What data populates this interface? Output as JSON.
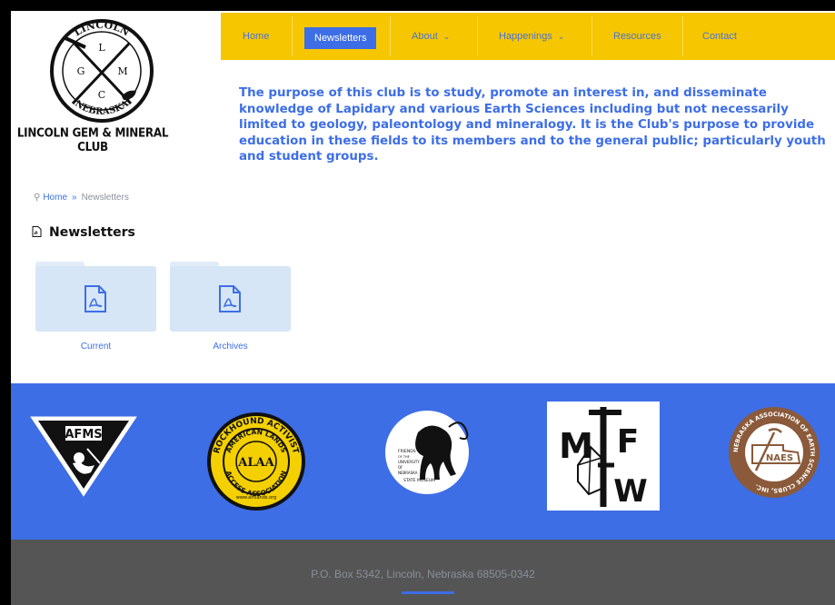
{
  "logo": {
    "arc_top": "LINCOLN",
    "arc_bottom": "NEBRASKA",
    "letters": [
      "L",
      "G",
      "M",
      "C"
    ],
    "caption": "LINCOLN GEM & MINERAL CLUB"
  },
  "nav": {
    "items": [
      {
        "label": "Home"
      },
      {
        "label": "Newsletters",
        "active": true
      },
      {
        "label": "About",
        "caret": "⌄"
      },
      {
        "label": "Happenings",
        "caret": "⌄"
      },
      {
        "label": "Resources"
      },
      {
        "label": "Contact"
      }
    ]
  },
  "purpose": "The purpose of this club is to study, promote an interest in, and disseminate knowledge of Lapidary and various Earth Sciences including but not necessarily limited to geology, paleontology and mineralogy. It is the Club's purpose to provide education in these fields to its members and to the general public; particularly youth and student groups.",
  "breadcrumb": {
    "home": "Home",
    "separator": "»",
    "current": "Newsletters"
  },
  "section": {
    "title": "Newsletters"
  },
  "folders": [
    {
      "label": "Current"
    },
    {
      "label": "Archives"
    }
  ],
  "partner_logos": {
    "afms": "AFMS",
    "alaa": {
      "outer_top": "ROCKHOUND ACTIVIST",
      "inner": "AMERICAN LANDS",
      "center": "ALAA",
      "bottom": "ACCESS ASSOCIATION",
      "url": "www.amlands.org"
    },
    "museum": [
      "FRIENDS",
      "OF THE",
      "UNIVERSITY",
      "OF",
      "NEBRASKA",
      "STATE MUSEUM"
    ],
    "mfw": [
      "M",
      "F",
      "W"
    ],
    "naes": {
      "center": "NAES",
      "ring": "NEBRASKA ASSOCIATION OF EARTH SCIENCE CLUBS, INC."
    }
  },
  "footer": {
    "address": "P.O. Box 5342, Lincoln, Nebraska 68505-0342"
  },
  "colors": {
    "primary": "#3d6ee6",
    "nav_bg": "#f6c600",
    "footer_bg": "#555555",
    "naes_brown": "#8a5a3a",
    "alaa_yellow": "#f4d000"
  }
}
